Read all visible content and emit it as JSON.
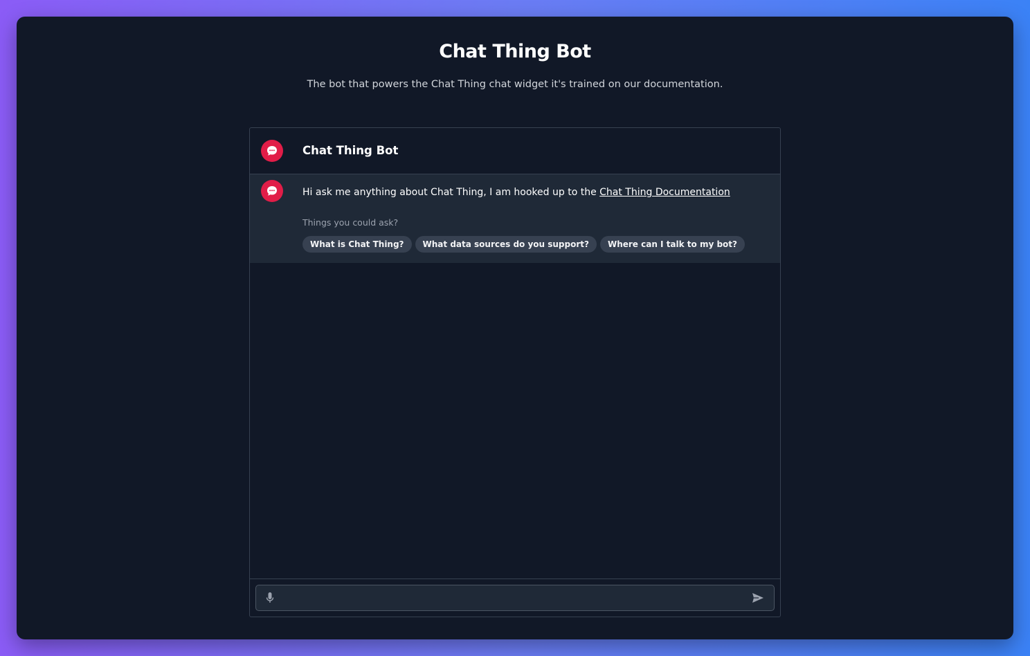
{
  "page": {
    "title": "Chat Thing Bot",
    "subtitle": "The bot that powers the Chat Thing chat widget it's trained on our documentation."
  },
  "chat": {
    "header_title": "Chat Thing Bot",
    "greeting_prefix": "Hi ask me anything about Chat Thing, I am hooked up to the ",
    "greeting_link": "Chat Thing Documentation",
    "suggestions_label": "Things you could ask?",
    "suggestions": [
      "What is Chat Thing?",
      "What data sources do you support?",
      "Where can I talk to my bot?"
    ],
    "input_value": "",
    "input_placeholder": ""
  },
  "icons": {
    "avatar": "chat-bubble-icon",
    "mic": "microphone-icon",
    "send": "send-icon"
  },
  "colors": {
    "background_gradient_start": "#8b5cf6",
    "background_gradient_end": "#3b82f6",
    "panel": "#111827",
    "message_bg": "#1f2937",
    "avatar_accent": "#e11d48",
    "chip_bg": "#374151"
  }
}
